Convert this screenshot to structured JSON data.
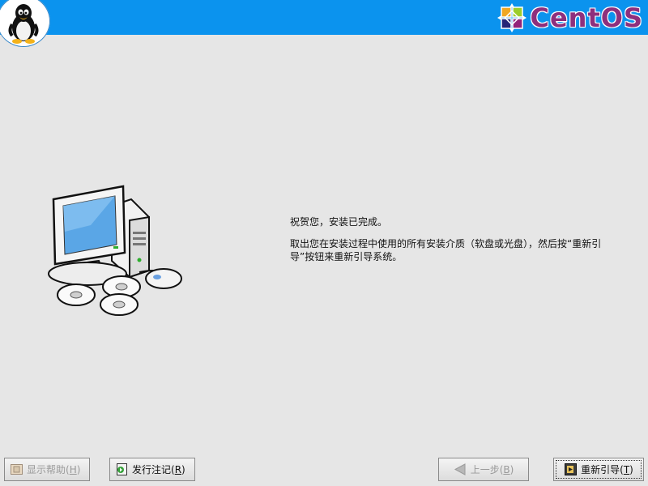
{
  "header": {
    "logo_text": "CentOS",
    "accent": "#0b93ee",
    "logo_color": "#8e2f7d"
  },
  "message": {
    "line1": "祝贺您，安装已完成。",
    "line2": "取出您在安装过程中使用的所有安装介质（软盘或光盘），然后按“重新引导”按钮来重新引导系统。"
  },
  "buttons": {
    "help": {
      "label": "显示帮助(",
      "mnemonic": "H",
      "suffix": ")",
      "icon": "help-book-icon",
      "enabled": false
    },
    "release_notes": {
      "label": "发行注记(",
      "mnemonic": "R",
      "suffix": ")",
      "icon": "release-notes-icon",
      "enabled": true
    },
    "back": {
      "label": "上一步(",
      "mnemonic": "B",
      "suffix": ")",
      "icon": "back-arrow-icon",
      "enabled": false
    },
    "reboot": {
      "label": "重新引导(",
      "mnemonic": "T",
      "suffix": ")",
      "icon": "reboot-icon",
      "enabled": true
    }
  }
}
